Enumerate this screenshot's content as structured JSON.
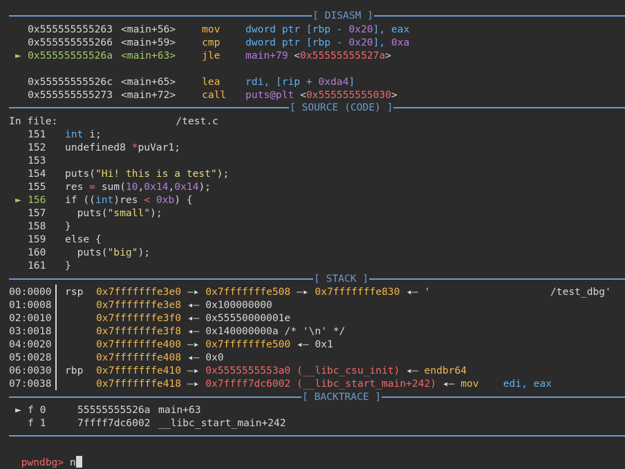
{
  "colors": {
    "separator": "#6b9bd1",
    "background": "#2b2b2b"
  },
  "disasm": {
    "title": "[ DISASM ]",
    "rows": [
      {
        "marker": "",
        "addr": "0x555555555263",
        "sym": "<main+56>",
        "mnem": "mov",
        "op1": "dword ptr [rbp - ",
        "op1num": "0x20",
        "op1end": "], ",
        "op2": "eax",
        "current": false
      },
      {
        "marker": "",
        "addr": "0x555555555266",
        "sym": "<main+59>",
        "mnem": "cmp",
        "op1": "dword ptr [rbp - ",
        "op1num": "0x20",
        "op1end": "], ",
        "op2": "0xa",
        "current": false
      },
      {
        "marker": "►",
        "addr": "0x55555555526a",
        "sym": "<main+63>",
        "mnem": "jle",
        "op1": "main+79 <",
        "op1num": "0x55555555527a",
        "op1end": ">",
        "op2": "",
        "current": true
      },
      {
        "marker": "",
        "addr": "0x55555555526c",
        "sym": "<main+65>",
        "mnem": "lea",
        "op1": "rdi, [rip + ",
        "op1num": "0xda4",
        "op1end": "]",
        "op2": "",
        "current": false
      },
      {
        "marker": "",
        "addr": "0x555555555273",
        "sym": "<main+72>",
        "mnem": "call",
        "op1": "puts@plt <",
        "op1num": "0x555555555030",
        "op1end": ">",
        "op2": "",
        "current": false
      }
    ]
  },
  "source": {
    "title": "[ SOURCE (CODE) ]",
    "file_label": "In file:",
    "file_path": "/test.c",
    "lines": [
      {
        "no": "151",
        "marker": "",
        "text": "int i;"
      },
      {
        "no": "152",
        "marker": "",
        "text": "undefined8 *puVar1;"
      },
      {
        "no": "153",
        "marker": "",
        "text": ""
      },
      {
        "no": "154",
        "marker": "",
        "text": "puts(\"Hi! this is a test\");"
      },
      {
        "no": "155",
        "marker": "",
        "text": "res = sum(10,0x14,0x14);"
      },
      {
        "no": "156",
        "marker": "►",
        "text": "if ((int)res < 0xb) {"
      },
      {
        "no": "157",
        "marker": "",
        "text": "  puts(\"small\");"
      },
      {
        "no": "158",
        "marker": "",
        "text": "}"
      },
      {
        "no": "159",
        "marker": "",
        "text": "else {"
      },
      {
        "no": "160",
        "marker": "",
        "text": "  puts(\"big\");"
      },
      {
        "no": "161",
        "marker": "",
        "text": "}"
      }
    ]
  },
  "stack": {
    "title": "[ STACK ]",
    "rows": [
      {
        "off": "00:0000",
        "reg": "rsp",
        "addr": "0x7fffffffe3e0",
        "a1": "—▸",
        "v1": "0x7fffffffe508",
        "a2": "—▸",
        "v2": "0x7fffffffe830",
        "a3": "◂—",
        "v3": "'",
        "tail": "/test_dbg'"
      },
      {
        "off": "01:0008",
        "reg": "",
        "addr": "0x7fffffffe3e8",
        "a1": "◂—",
        "v1": "0x100000000",
        "a2": "",
        "v2": "",
        "a3": "",
        "v3": "",
        "tail": ""
      },
      {
        "off": "02:0010",
        "reg": "",
        "addr": "0x7fffffffe3f0",
        "a1": "◂—",
        "v1": "0x55550000001e",
        "a2": "",
        "v2": "",
        "a3": "",
        "v3": "",
        "tail": ""
      },
      {
        "off": "03:0018",
        "reg": "",
        "addr": "0x7fffffffe3f8",
        "a1": "◂—",
        "v1": "0x140000000a /* '\\n' */",
        "a2": "",
        "v2": "",
        "a3": "",
        "v3": "",
        "tail": ""
      },
      {
        "off": "04:0020",
        "reg": "",
        "addr": "0x7fffffffe400",
        "a1": "—▸",
        "v1": "0x7fffffffe500",
        "a2": "◂—",
        "v2": "0x1",
        "a3": "",
        "v3": "",
        "tail": ""
      },
      {
        "off": "05:0028",
        "reg": "",
        "addr": "0x7fffffffe408",
        "a1": "◂—",
        "v1": "0x0",
        "a2": "",
        "v2": "",
        "a3": "",
        "v3": "",
        "tail": ""
      },
      {
        "off": "06:0030",
        "reg": "rbp",
        "addr": "0x7fffffffe410",
        "a1": "—▸",
        "v1": "0x5555555553a0 (__libc_csu_init)",
        "a2": "◂—",
        "v2": "endbr64",
        "a3": "",
        "v3": "",
        "tail": ""
      },
      {
        "off": "07:0038",
        "reg": "",
        "addr": "0x7fffffffe418",
        "a1": "—▸",
        "v1": "0x7ffff7dc6002 (__libc_start_main+242)",
        "a2": "◂—",
        "v2": "mov",
        "a3": "",
        "v3": "edi, eax",
        "tail": ""
      }
    ]
  },
  "backtrace": {
    "title": "[ BACKTRACE ]",
    "frames": [
      {
        "marker": "►",
        "frame": "f 0",
        "addr": "55555555526a",
        "sym": "main+63"
      },
      {
        "marker": "",
        "frame": "f 1",
        "addr": "7ffff7dc6002",
        "sym": "__libc_start_main+242"
      }
    ]
  },
  "prompt": {
    "label": "pwndbg>",
    "input": "n"
  }
}
